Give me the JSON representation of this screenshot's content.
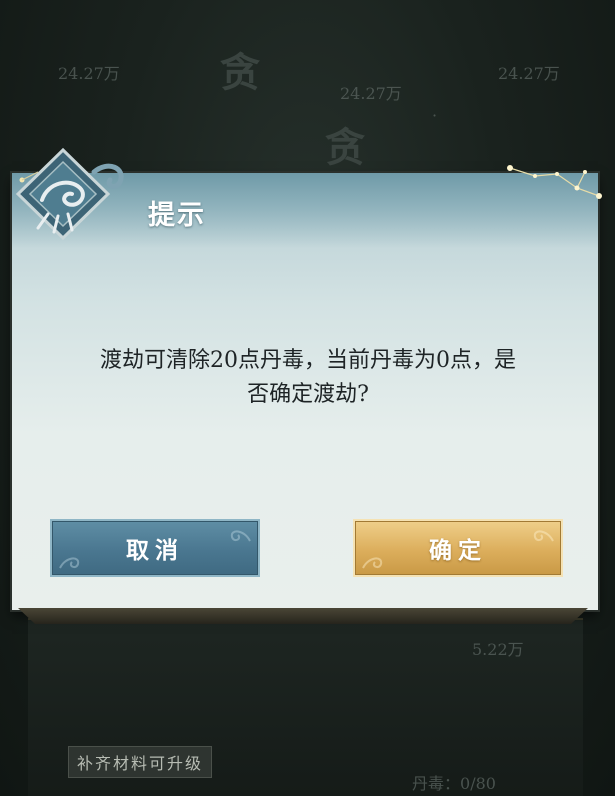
{
  "background": {
    "top_texts": [
      "24.27万",
      "24.27万",
      "24.27万"
    ],
    "mid_right_text": "5.22万",
    "bottom_tag": "补齐材料可升级",
    "bottom_right_label": "丹毒：",
    "bottom_right_value": "0/80"
  },
  "dialog": {
    "title": "提示",
    "message_line1": "渡劫可清除20点丹毒，当前丹毒为0点，是",
    "message_line2": "否确定渡劫?",
    "cancel_label": "取消",
    "confirm_label": "确定"
  },
  "colors": {
    "cancel_button": "#4a7790",
    "confirm_button": "#dcae5c",
    "dialog_header": "#6f9aa8"
  },
  "icons": {
    "emblem": "dragon-emblem-icon",
    "constellation": "constellation-icon"
  }
}
